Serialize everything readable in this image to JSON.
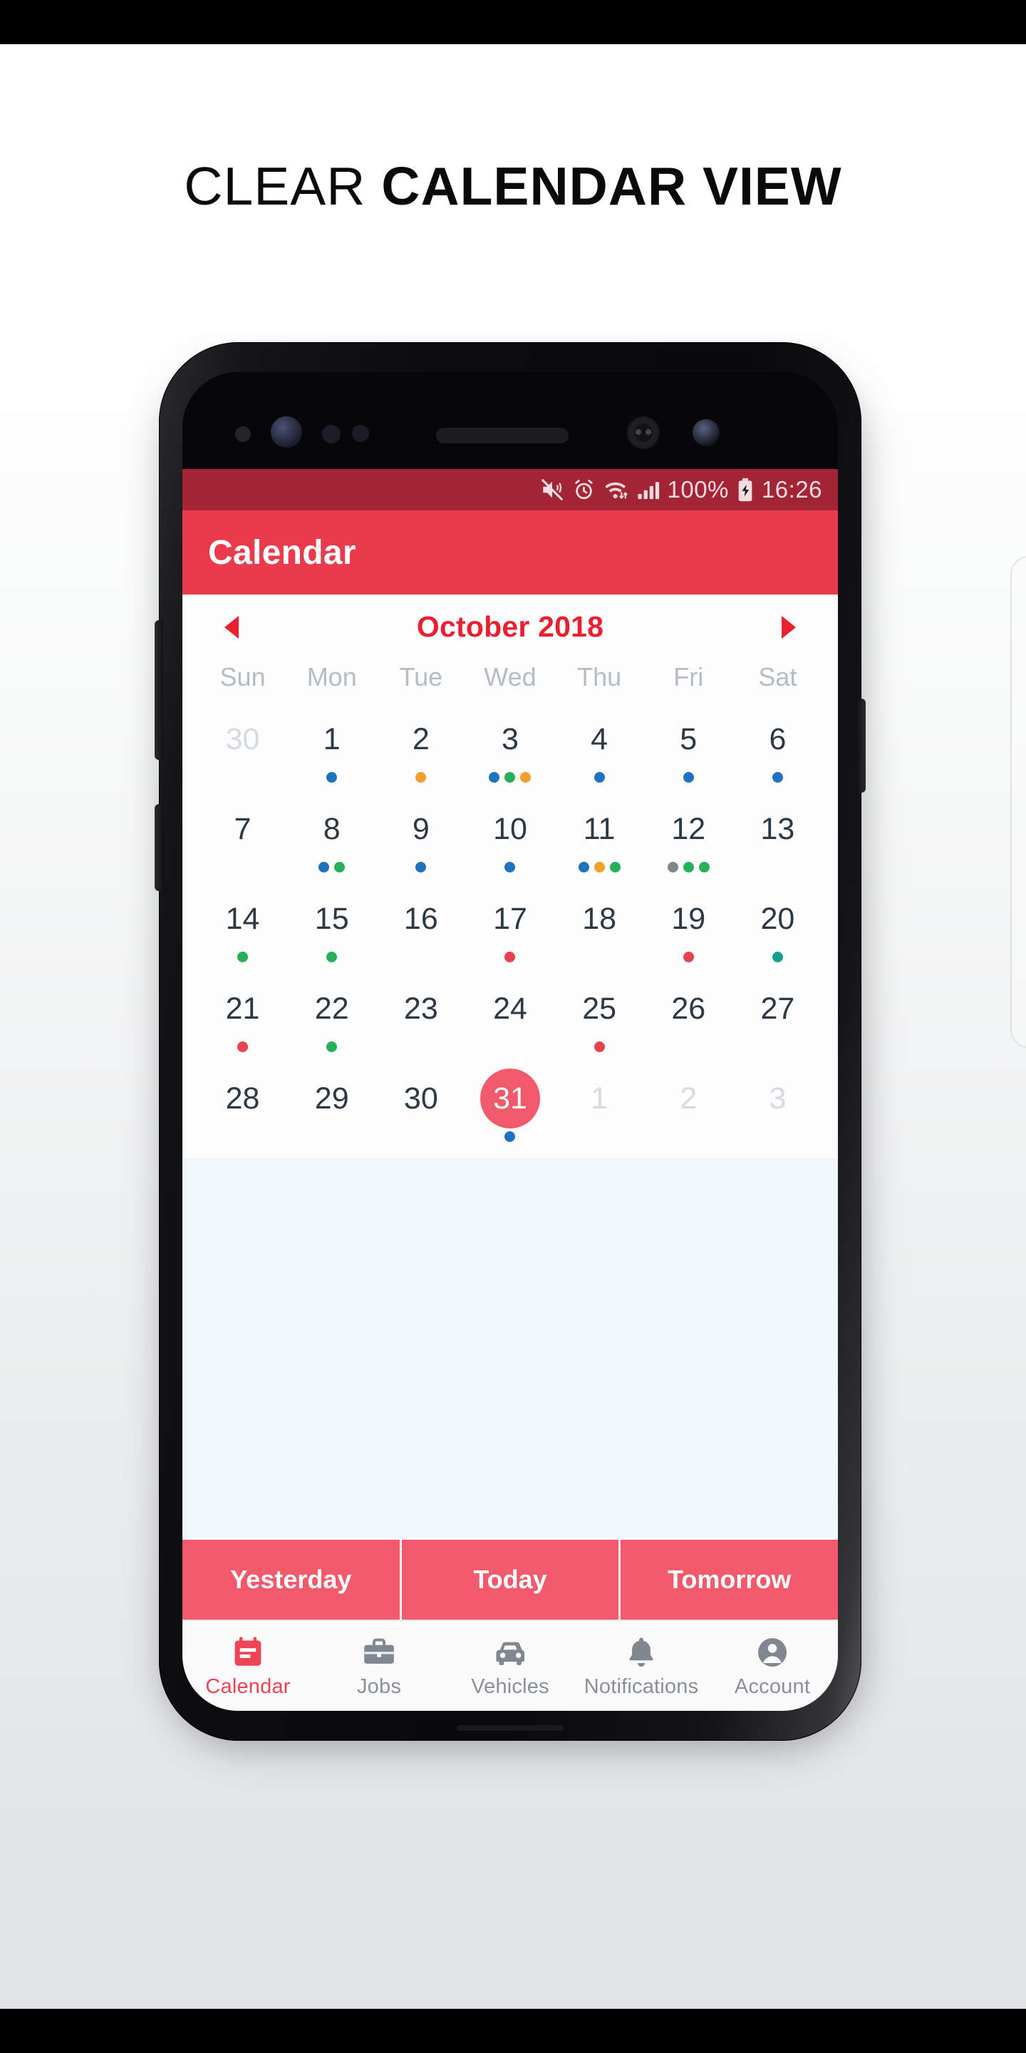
{
  "headline": {
    "light": "CLEAR ",
    "bold": "CALENDAR VIEW"
  },
  "colors": {
    "statusbar_bg": "#A32434",
    "appbar_bg": "#EA3B4C",
    "accent_red": "#E8202F",
    "selected_red": "#F2596A",
    "quicknav_bg": "#F2596A",
    "empty_bg": "#F2F7FC",
    "dot_blue": "#1F72C0",
    "dot_orange": "#F2A02C",
    "dot_green": "#27B05A",
    "dot_teal": "#17A08A",
    "dot_red": "#E8414F",
    "dot_gray": "#7E8790",
    "weekday_gray": "#B4BCC6",
    "day_text": "#2C3843",
    "muted_day": "#D6DBE0"
  },
  "statusbar": {
    "icons": [
      "mute-vibrate-icon",
      "alarm-icon",
      "wifi-icon",
      "signal-icon",
      "battery-charging-icon"
    ],
    "battery_percent": "100%",
    "clock": "16:26"
  },
  "appbar": {
    "title": "Calendar"
  },
  "calendar": {
    "prev_label": "◀",
    "next_label": "▶",
    "month_label": "October 2018",
    "weekdays": [
      "Sun",
      "Mon",
      "Tue",
      "Wed",
      "Thu",
      "Fri",
      "Sat"
    ],
    "weeks": [
      [
        {
          "num": "30",
          "muted": true,
          "selected": false,
          "dots": []
        },
        {
          "num": "1",
          "muted": false,
          "selected": false,
          "dots": [
            "blue"
          ]
        },
        {
          "num": "2",
          "muted": false,
          "selected": false,
          "dots": [
            "orange"
          ]
        },
        {
          "num": "3",
          "muted": false,
          "selected": false,
          "dots": [
            "blue",
            "green",
            "orange"
          ]
        },
        {
          "num": "4",
          "muted": false,
          "selected": false,
          "dots": [
            "blue"
          ]
        },
        {
          "num": "5",
          "muted": false,
          "selected": false,
          "dots": [
            "blue"
          ]
        },
        {
          "num": "6",
          "muted": false,
          "selected": false,
          "dots": [
            "blue"
          ]
        }
      ],
      [
        {
          "num": "7",
          "muted": false,
          "selected": false,
          "dots": []
        },
        {
          "num": "8",
          "muted": false,
          "selected": false,
          "dots": [
            "blue",
            "green"
          ]
        },
        {
          "num": "9",
          "muted": false,
          "selected": false,
          "dots": [
            "blue"
          ]
        },
        {
          "num": "10",
          "muted": false,
          "selected": false,
          "dots": [
            "blue"
          ]
        },
        {
          "num": "11",
          "muted": false,
          "selected": false,
          "dots": [
            "blue",
            "orange",
            "green"
          ]
        },
        {
          "num": "12",
          "muted": false,
          "selected": false,
          "dots": [
            "gray",
            "green",
            "green"
          ]
        },
        {
          "num": "13",
          "muted": false,
          "selected": false,
          "dots": []
        }
      ],
      [
        {
          "num": "14",
          "muted": false,
          "selected": false,
          "dots": [
            "green"
          ]
        },
        {
          "num": "15",
          "muted": false,
          "selected": false,
          "dots": [
            "green"
          ]
        },
        {
          "num": "16",
          "muted": false,
          "selected": false,
          "dots": []
        },
        {
          "num": "17",
          "muted": false,
          "selected": false,
          "dots": [
            "red"
          ]
        },
        {
          "num": "18",
          "muted": false,
          "selected": false,
          "dots": []
        },
        {
          "num": "19",
          "muted": false,
          "selected": false,
          "dots": [
            "red"
          ]
        },
        {
          "num": "20",
          "muted": false,
          "selected": false,
          "dots": [
            "teal"
          ]
        }
      ],
      [
        {
          "num": "21",
          "muted": false,
          "selected": false,
          "dots": [
            "red"
          ]
        },
        {
          "num": "22",
          "muted": false,
          "selected": false,
          "dots": [
            "green"
          ]
        },
        {
          "num": "23",
          "muted": false,
          "selected": false,
          "dots": []
        },
        {
          "num": "24",
          "muted": false,
          "selected": false,
          "dots": []
        },
        {
          "num": "25",
          "muted": false,
          "selected": false,
          "dots": [
            "red"
          ]
        },
        {
          "num": "26",
          "muted": false,
          "selected": false,
          "dots": []
        },
        {
          "num": "27",
          "muted": false,
          "selected": false,
          "dots": []
        }
      ],
      [
        {
          "num": "28",
          "muted": false,
          "selected": false,
          "dots": []
        },
        {
          "num": "29",
          "muted": false,
          "selected": false,
          "dots": []
        },
        {
          "num": "30",
          "muted": false,
          "selected": false,
          "dots": []
        },
        {
          "num": "31",
          "muted": false,
          "selected": true,
          "dots": [
            "blue"
          ]
        },
        {
          "num": "1",
          "muted": true,
          "selected": false,
          "dots": []
        },
        {
          "num": "2",
          "muted": true,
          "selected": false,
          "dots": []
        },
        {
          "num": "3",
          "muted": true,
          "selected": false,
          "dots": []
        }
      ]
    ]
  },
  "quicknav": [
    {
      "label": "Yesterday"
    },
    {
      "label": "Today"
    },
    {
      "label": "Tomorrow"
    }
  ],
  "bottomnav": [
    {
      "label": "Calendar",
      "icon": "calendar-icon",
      "active": true
    },
    {
      "label": "Jobs",
      "icon": "briefcase-icon",
      "active": false
    },
    {
      "label": "Vehicles",
      "icon": "car-icon",
      "active": false
    },
    {
      "label": "Notifications",
      "icon": "bell-icon",
      "active": false
    },
    {
      "label": "Account",
      "icon": "account-icon",
      "active": false
    }
  ]
}
